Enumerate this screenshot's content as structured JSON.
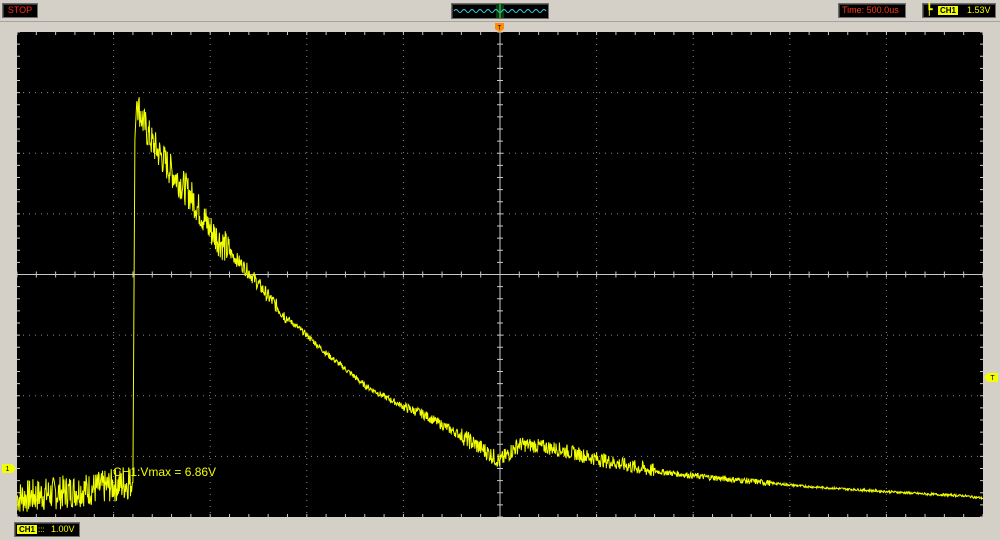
{
  "status": {
    "run_state": "STOP"
  },
  "timebase": {
    "label": "Time: 500.0us"
  },
  "trigger": {
    "edge_icon": "rising-edge-icon",
    "channel": "CH1",
    "level": "1.53V",
    "position_marker": "T",
    "level_marker": "T"
  },
  "channel": {
    "name": "CH1",
    "coupling_icon": "dc-coupling-icon",
    "coupling_glyph": ":::",
    "volts_per_div": "1.00V",
    "ground_marker": "1"
  },
  "measurement": {
    "text": "CH1:Vmax = 6.86V"
  },
  "colors": {
    "trace": "#f2ff00",
    "grid": "#c8c8c8",
    "background": "#000000",
    "stop_text": "#ff2b1a",
    "marker": "#ff8c00"
  },
  "chart_data": {
    "type": "line",
    "title": "",
    "xlabel": "",
    "ylabel": "",
    "x_unit": "us",
    "y_unit": "V",
    "divisions": {
      "x": 10,
      "y": 8
    },
    "x_per_div": 500,
    "y_per_div": 1.0,
    "xlim": [
      -2500,
      2500
    ],
    "ylim": [
      -3.02,
      4.98
    ],
    "grid": true,
    "series": [
      {
        "x": [
          -2500,
          -2100,
          -1900,
          -1890,
          -1880,
          -1850,
          -1800,
          -1700,
          -1600,
          -1500,
          -1400,
          -1300,
          -1200,
          -1100,
          -1000,
          -900,
          -800,
          -700,
          -600,
          -500,
          -400,
          -300,
          -200,
          -100,
          0,
          100,
          200,
          300,
          400,
          500,
          600,
          700,
          800,
          900,
          1000,
          1200,
          1400,
          1600,
          1800,
          2000,
          2200,
          2400,
          2500
        ],
        "y": [
          -2.7,
          -2.55,
          -2.45,
          3.2,
          3.84,
          3.52,
          3.15,
          2.68,
          2.28,
          1.72,
          1.35,
          1.02,
          0.62,
          0.25,
          -0.02,
          -0.32,
          -0.58,
          -0.85,
          -1.03,
          -1.2,
          -1.32,
          -1.5,
          -1.68,
          -1.88,
          -2.1,
          -1.82,
          -1.85,
          -1.9,
          -1.98,
          -2.06,
          -2.13,
          -2.2,
          -2.26,
          -2.3,
          -2.34,
          -2.4,
          -2.46,
          -2.52,
          -2.56,
          -2.6,
          -2.64,
          -2.67,
          -2.71
        ]
      }
    ]
  }
}
